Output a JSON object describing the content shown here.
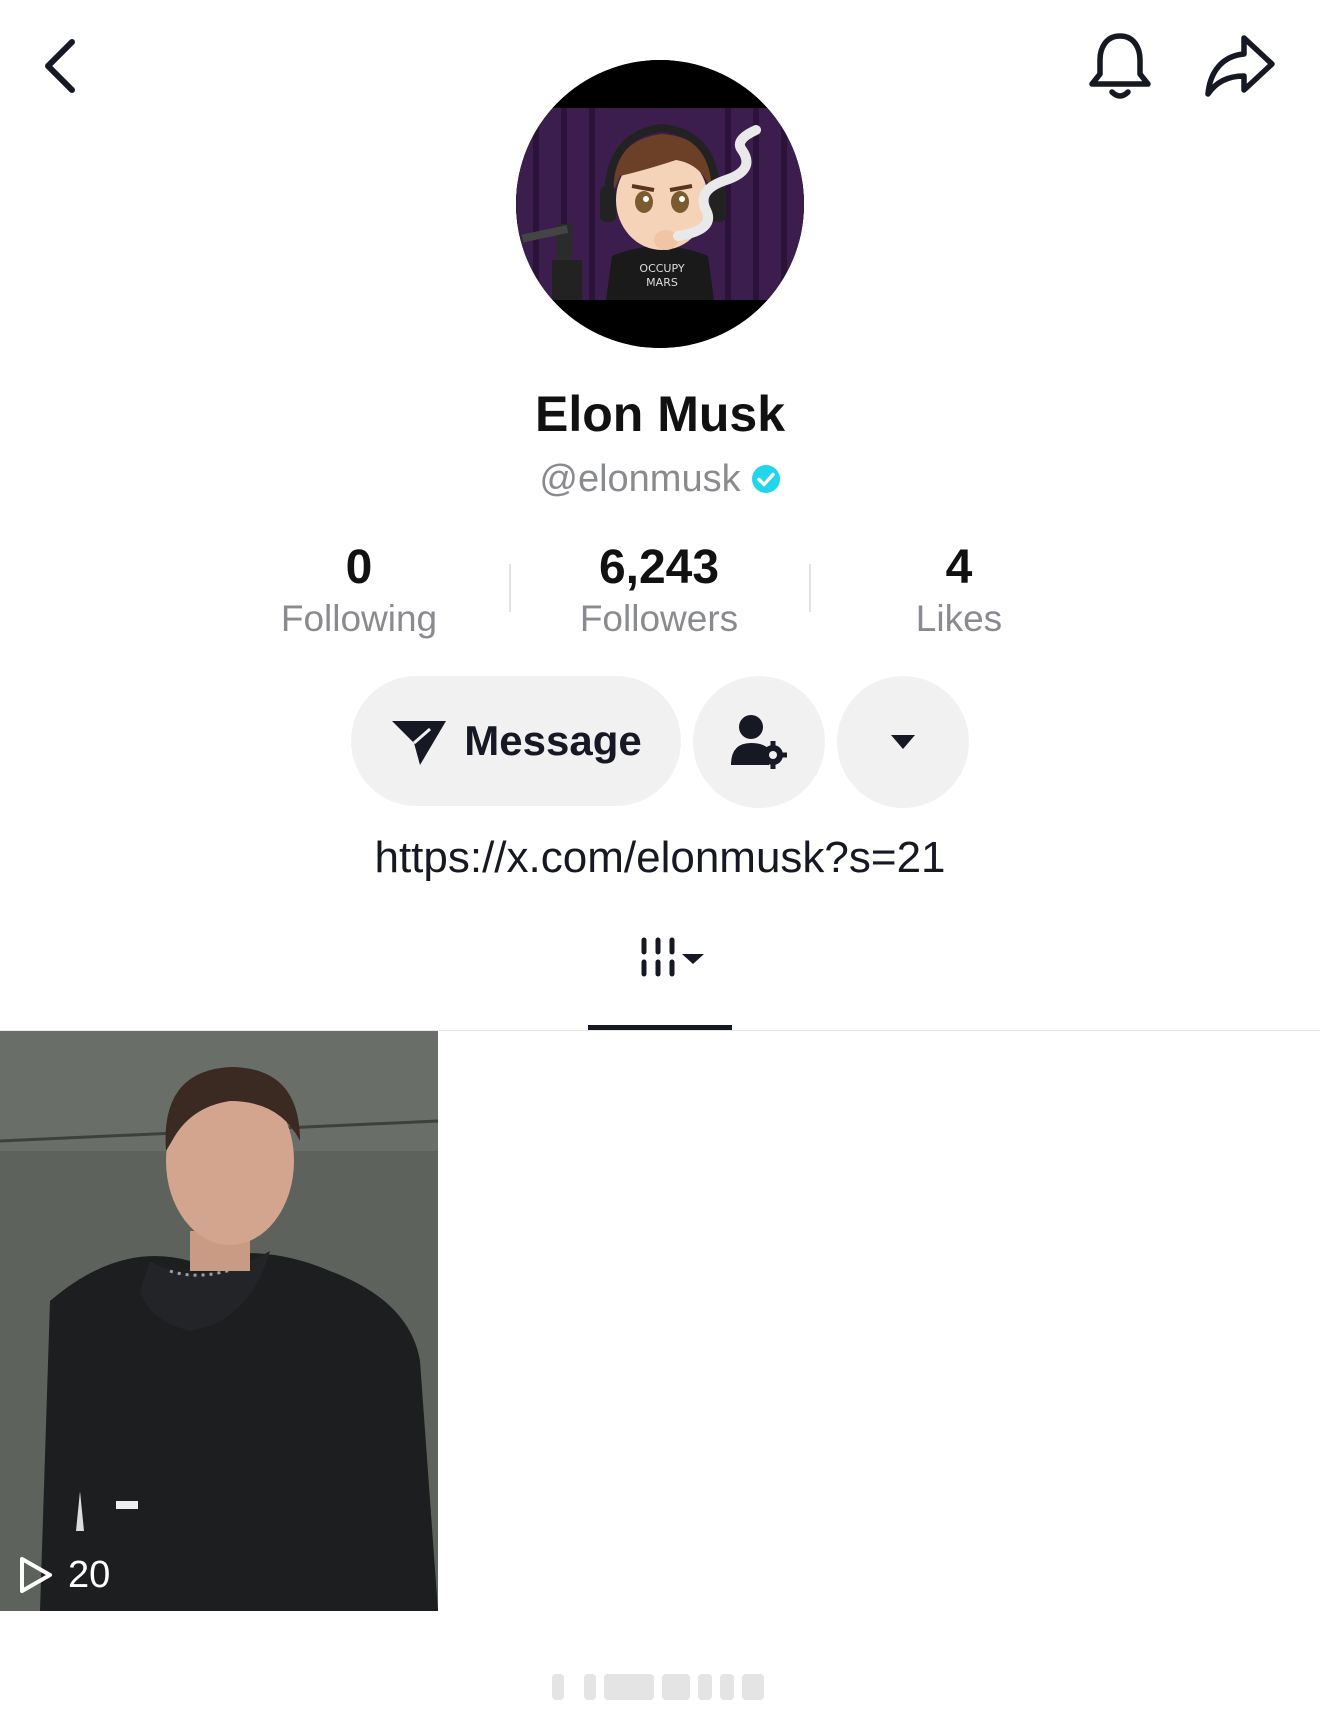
{
  "topbar": {
    "back_icon": "chevron-left-icon",
    "bell_icon": "bell-icon",
    "share_icon": "share-arrow-icon"
  },
  "profile": {
    "avatar": {
      "description_icon": "avatar-image",
      "shirt_text": "OCCUPY MARS"
    },
    "display_name": "Elon Musk",
    "handle": "@elonmusk",
    "verified": true,
    "verified_color": "#20d5ec",
    "bio_link": "https://x.com/elonmusk?s=21"
  },
  "stats": [
    {
      "value": "0",
      "label": "Following"
    },
    {
      "value": "6,243",
      "label": "Followers"
    },
    {
      "value": "4",
      "label": "Likes"
    }
  ],
  "actions": {
    "message_label": "Message",
    "message_icon": "paper-plane-icon",
    "user_settings_icon": "user-settings-icon",
    "more_icon": "caret-down-icon"
  },
  "tabs": {
    "videos_icon": "grid-lines-icon",
    "dropdown_icon": "caret-down-icon"
  },
  "videos": [
    {
      "play_count": "20",
      "play_icon": "play-outline-icon"
    }
  ],
  "colors": {
    "text_primary": "#161823",
    "text_secondary": "#8a8b91",
    "button_bg": "#f1f1f2"
  }
}
